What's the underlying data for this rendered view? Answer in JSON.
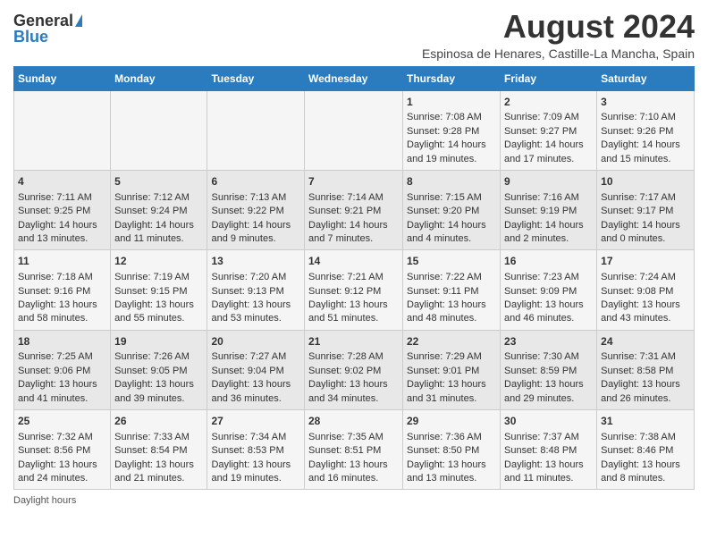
{
  "logo": {
    "general": "General",
    "blue": "Blue"
  },
  "title": "August 2024",
  "subtitle": "Espinosa de Henares, Castille-La Mancha, Spain",
  "days_of_week": [
    "Sunday",
    "Monday",
    "Tuesday",
    "Wednesday",
    "Thursday",
    "Friday",
    "Saturday"
  ],
  "weeks": [
    [
      {
        "day": "",
        "sunrise": "",
        "sunset": "",
        "daylight": ""
      },
      {
        "day": "",
        "sunrise": "",
        "sunset": "",
        "daylight": ""
      },
      {
        "day": "",
        "sunrise": "",
        "sunset": "",
        "daylight": ""
      },
      {
        "day": "",
        "sunrise": "",
        "sunset": "",
        "daylight": ""
      },
      {
        "day": "1",
        "sunrise": "Sunrise: 7:08 AM",
        "sunset": "Sunset: 9:28 PM",
        "daylight": "Daylight: 14 hours and 19 minutes."
      },
      {
        "day": "2",
        "sunrise": "Sunrise: 7:09 AM",
        "sunset": "Sunset: 9:27 PM",
        "daylight": "Daylight: 14 hours and 17 minutes."
      },
      {
        "day": "3",
        "sunrise": "Sunrise: 7:10 AM",
        "sunset": "Sunset: 9:26 PM",
        "daylight": "Daylight: 14 hours and 15 minutes."
      }
    ],
    [
      {
        "day": "4",
        "sunrise": "Sunrise: 7:11 AM",
        "sunset": "Sunset: 9:25 PM",
        "daylight": "Daylight: 14 hours and 13 minutes."
      },
      {
        "day": "5",
        "sunrise": "Sunrise: 7:12 AM",
        "sunset": "Sunset: 9:24 PM",
        "daylight": "Daylight: 14 hours and 11 minutes."
      },
      {
        "day": "6",
        "sunrise": "Sunrise: 7:13 AM",
        "sunset": "Sunset: 9:22 PM",
        "daylight": "Daylight: 14 hours and 9 minutes."
      },
      {
        "day": "7",
        "sunrise": "Sunrise: 7:14 AM",
        "sunset": "Sunset: 9:21 PM",
        "daylight": "Daylight: 14 hours and 7 minutes."
      },
      {
        "day": "8",
        "sunrise": "Sunrise: 7:15 AM",
        "sunset": "Sunset: 9:20 PM",
        "daylight": "Daylight: 14 hours and 4 minutes."
      },
      {
        "day": "9",
        "sunrise": "Sunrise: 7:16 AM",
        "sunset": "Sunset: 9:19 PM",
        "daylight": "Daylight: 14 hours and 2 minutes."
      },
      {
        "day": "10",
        "sunrise": "Sunrise: 7:17 AM",
        "sunset": "Sunset: 9:17 PM",
        "daylight": "Daylight: 14 hours and 0 minutes."
      }
    ],
    [
      {
        "day": "11",
        "sunrise": "Sunrise: 7:18 AM",
        "sunset": "Sunset: 9:16 PM",
        "daylight": "Daylight: 13 hours and 58 minutes."
      },
      {
        "day": "12",
        "sunrise": "Sunrise: 7:19 AM",
        "sunset": "Sunset: 9:15 PM",
        "daylight": "Daylight: 13 hours and 55 minutes."
      },
      {
        "day": "13",
        "sunrise": "Sunrise: 7:20 AM",
        "sunset": "Sunset: 9:13 PM",
        "daylight": "Daylight: 13 hours and 53 minutes."
      },
      {
        "day": "14",
        "sunrise": "Sunrise: 7:21 AM",
        "sunset": "Sunset: 9:12 PM",
        "daylight": "Daylight: 13 hours and 51 minutes."
      },
      {
        "day": "15",
        "sunrise": "Sunrise: 7:22 AM",
        "sunset": "Sunset: 9:11 PM",
        "daylight": "Daylight: 13 hours and 48 minutes."
      },
      {
        "day": "16",
        "sunrise": "Sunrise: 7:23 AM",
        "sunset": "Sunset: 9:09 PM",
        "daylight": "Daylight: 13 hours and 46 minutes."
      },
      {
        "day": "17",
        "sunrise": "Sunrise: 7:24 AM",
        "sunset": "Sunset: 9:08 PM",
        "daylight": "Daylight: 13 hours and 43 minutes."
      }
    ],
    [
      {
        "day": "18",
        "sunrise": "Sunrise: 7:25 AM",
        "sunset": "Sunset: 9:06 PM",
        "daylight": "Daylight: 13 hours and 41 minutes."
      },
      {
        "day": "19",
        "sunrise": "Sunrise: 7:26 AM",
        "sunset": "Sunset: 9:05 PM",
        "daylight": "Daylight: 13 hours and 39 minutes."
      },
      {
        "day": "20",
        "sunrise": "Sunrise: 7:27 AM",
        "sunset": "Sunset: 9:04 PM",
        "daylight": "Daylight: 13 hours and 36 minutes."
      },
      {
        "day": "21",
        "sunrise": "Sunrise: 7:28 AM",
        "sunset": "Sunset: 9:02 PM",
        "daylight": "Daylight: 13 hours and 34 minutes."
      },
      {
        "day": "22",
        "sunrise": "Sunrise: 7:29 AM",
        "sunset": "Sunset: 9:01 PM",
        "daylight": "Daylight: 13 hours and 31 minutes."
      },
      {
        "day": "23",
        "sunrise": "Sunrise: 7:30 AM",
        "sunset": "Sunset: 8:59 PM",
        "daylight": "Daylight: 13 hours and 29 minutes."
      },
      {
        "day": "24",
        "sunrise": "Sunrise: 7:31 AM",
        "sunset": "Sunset: 8:58 PM",
        "daylight": "Daylight: 13 hours and 26 minutes."
      }
    ],
    [
      {
        "day": "25",
        "sunrise": "Sunrise: 7:32 AM",
        "sunset": "Sunset: 8:56 PM",
        "daylight": "Daylight: 13 hours and 24 minutes."
      },
      {
        "day": "26",
        "sunrise": "Sunrise: 7:33 AM",
        "sunset": "Sunset: 8:54 PM",
        "daylight": "Daylight: 13 hours and 21 minutes."
      },
      {
        "day": "27",
        "sunrise": "Sunrise: 7:34 AM",
        "sunset": "Sunset: 8:53 PM",
        "daylight": "Daylight: 13 hours and 19 minutes."
      },
      {
        "day": "28",
        "sunrise": "Sunrise: 7:35 AM",
        "sunset": "Sunset: 8:51 PM",
        "daylight": "Daylight: 13 hours and 16 minutes."
      },
      {
        "day": "29",
        "sunrise": "Sunrise: 7:36 AM",
        "sunset": "Sunset: 8:50 PM",
        "daylight": "Daylight: 13 hours and 13 minutes."
      },
      {
        "day": "30",
        "sunrise": "Sunrise: 7:37 AM",
        "sunset": "Sunset: 8:48 PM",
        "daylight": "Daylight: 13 hours and 11 minutes."
      },
      {
        "day": "31",
        "sunrise": "Sunrise: 7:38 AM",
        "sunset": "Sunset: 8:46 PM",
        "daylight": "Daylight: 13 hours and 8 minutes."
      }
    ]
  ],
  "footer": {
    "daylight_label": "Daylight hours"
  }
}
